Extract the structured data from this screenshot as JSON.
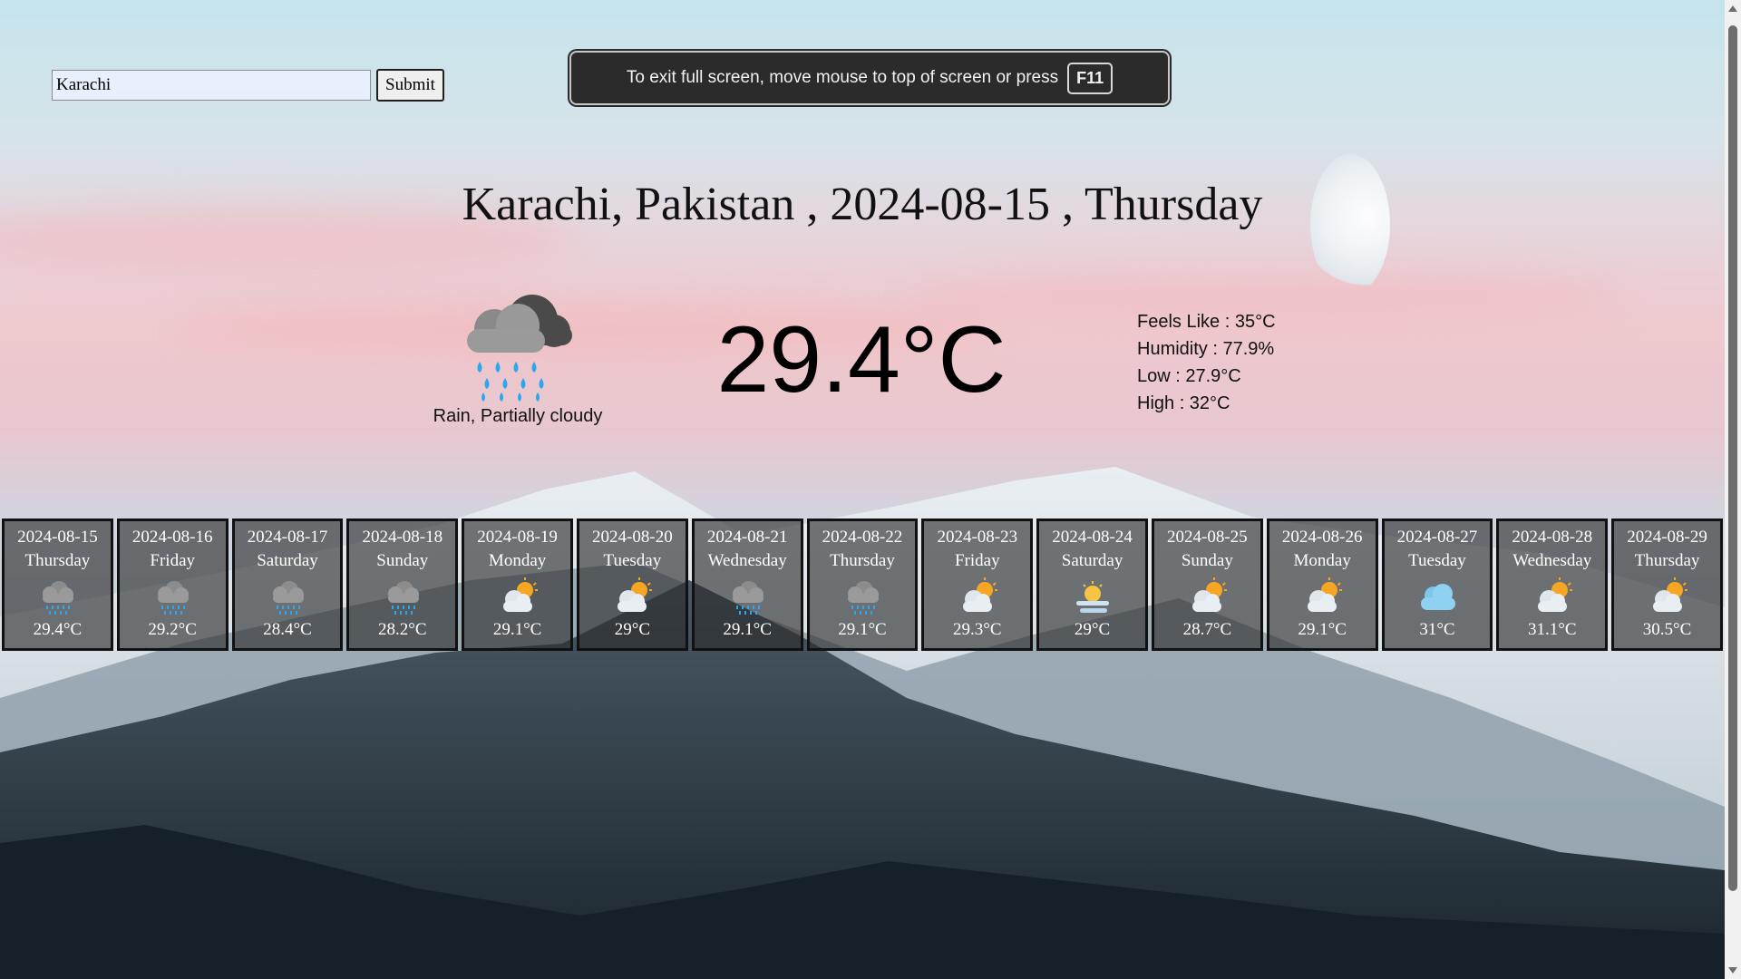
{
  "search": {
    "value": "Karachi",
    "submit_label": "Submit"
  },
  "fullscreen_banner": {
    "message": "To exit full screen, move mouse to top of screen or press",
    "key": "F11"
  },
  "current": {
    "title": "Karachi, Pakistan , 2024-08-15 , Thursday",
    "conditions": "Rain, Partially cloudy",
    "icon": "rain-cloud-icon",
    "temperature": "29.4°C",
    "feels_like": "Feels Like : 35°C",
    "humidity": "Humidity : 77.9%",
    "low": "Low : 27.9°C",
    "high": "High : 32°C"
  },
  "forecast": [
    {
      "date": "2024-08-15",
      "day": "Thursday",
      "temp": "29.4°C",
      "icon": "rain-icon"
    },
    {
      "date": "2024-08-16",
      "day": "Friday",
      "temp": "29.2°C",
      "icon": "rain-icon"
    },
    {
      "date": "2024-08-17",
      "day": "Saturday",
      "temp": "28.4°C",
      "icon": "rain-icon"
    },
    {
      "date": "2024-08-18",
      "day": "Sunday",
      "temp": "28.2°C",
      "icon": "rain-icon"
    },
    {
      "date": "2024-08-19",
      "day": "Monday",
      "temp": "29.1°C",
      "icon": "partly-cloudy-icon"
    },
    {
      "date": "2024-08-20",
      "day": "Tuesday",
      "temp": "29°C",
      "icon": "partly-cloudy-icon"
    },
    {
      "date": "2024-08-21",
      "day": "Wednesday",
      "temp": "29.1°C",
      "icon": "rain-icon"
    },
    {
      "date": "2024-08-22",
      "day": "Thursday",
      "temp": "29.1°C",
      "icon": "rain-icon"
    },
    {
      "date": "2024-08-23",
      "day": "Friday",
      "temp": "29.3°C",
      "icon": "partly-cloudy-icon"
    },
    {
      "date": "2024-08-24",
      "day": "Saturday",
      "temp": "29°C",
      "icon": "fog-sun-icon"
    },
    {
      "date": "2024-08-25",
      "day": "Sunday",
      "temp": "28.7°C",
      "icon": "partly-cloudy-icon"
    },
    {
      "date": "2024-08-26",
      "day": "Monday",
      "temp": "29.1°C",
      "icon": "partly-cloudy-icon"
    },
    {
      "date": "2024-08-27",
      "day": "Tuesday",
      "temp": "31°C",
      "icon": "cloudy-icon"
    },
    {
      "date": "2024-08-28",
      "day": "Wednesday",
      "temp": "31.1°C",
      "icon": "partly-cloudy-icon"
    },
    {
      "date": "2024-08-29",
      "day": "Thursday",
      "temp": "30.5°C",
      "icon": "partly-cloudy-icon"
    }
  ]
}
